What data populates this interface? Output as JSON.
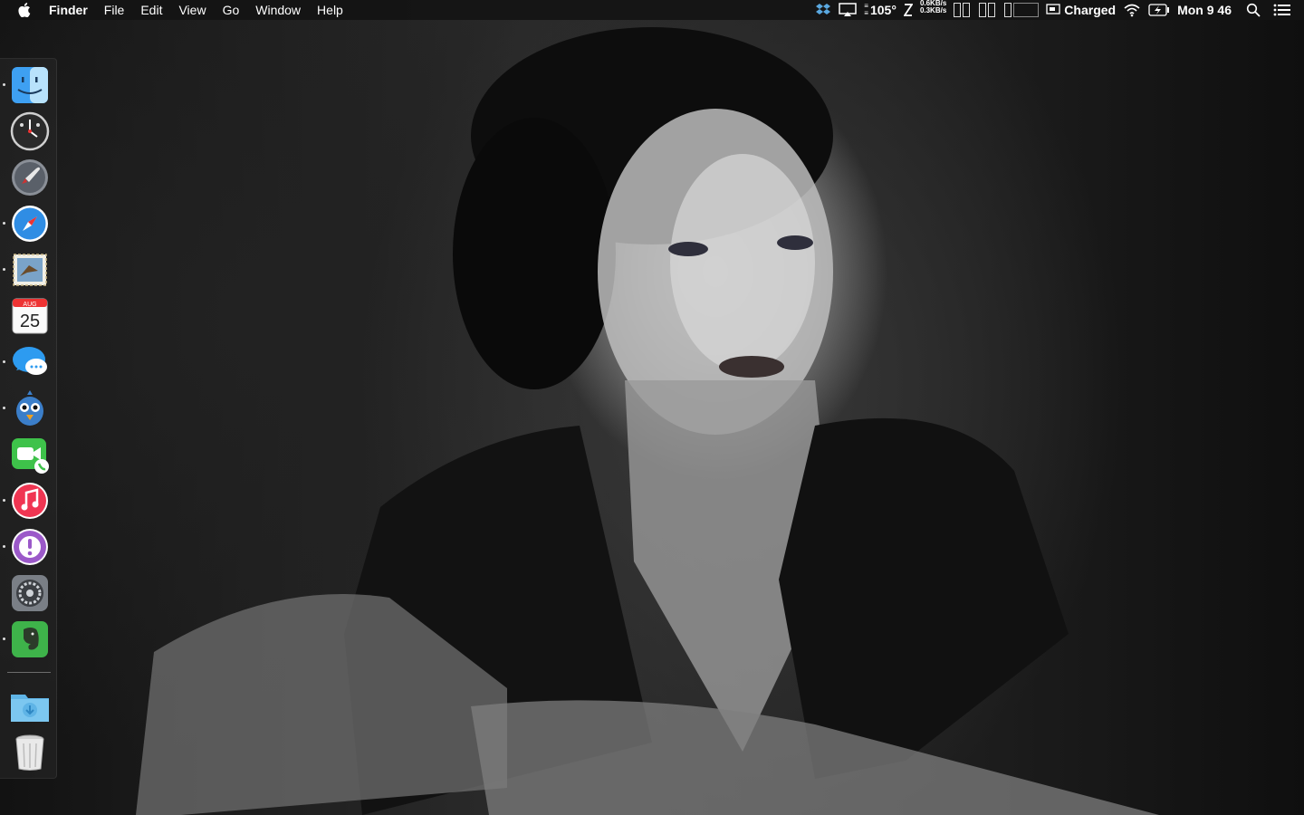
{
  "menubar": {
    "app_name": "Finder",
    "menus": [
      "File",
      "Edit",
      "View",
      "Go",
      "Window",
      "Help"
    ],
    "status": {
      "temperature": "105°",
      "net_up": "0.6KB/s",
      "net_down": "0.3KB/s",
      "battery_label": "Charged",
      "clock": "Mon 9 46"
    }
  },
  "dock": {
    "items": [
      {
        "name": "finder-icon",
        "running": true
      },
      {
        "name": "dashboard-icon",
        "running": false
      },
      {
        "name": "launchpad-icon",
        "running": false
      },
      {
        "name": "safari-icon",
        "running": true
      },
      {
        "name": "mail-icon",
        "running": true
      },
      {
        "name": "calendar-icon",
        "running": false,
        "month": "AUG",
        "day": "25"
      },
      {
        "name": "messages-icon",
        "running": true
      },
      {
        "name": "tweetbot-icon",
        "running": true
      },
      {
        "name": "facetime-icon",
        "running": false
      },
      {
        "name": "itunes-icon",
        "running": true
      },
      {
        "name": "feedback-assistant-icon",
        "running": true
      },
      {
        "name": "system-preferences-icon",
        "running": false
      },
      {
        "name": "evernote-icon",
        "running": true
      },
      {
        "name": "downloads-folder-icon",
        "running": false
      },
      {
        "name": "trash-icon",
        "running": false
      }
    ]
  },
  "colors": {
    "menubar_bg": "#141414",
    "dock_bg": "#282828"
  }
}
